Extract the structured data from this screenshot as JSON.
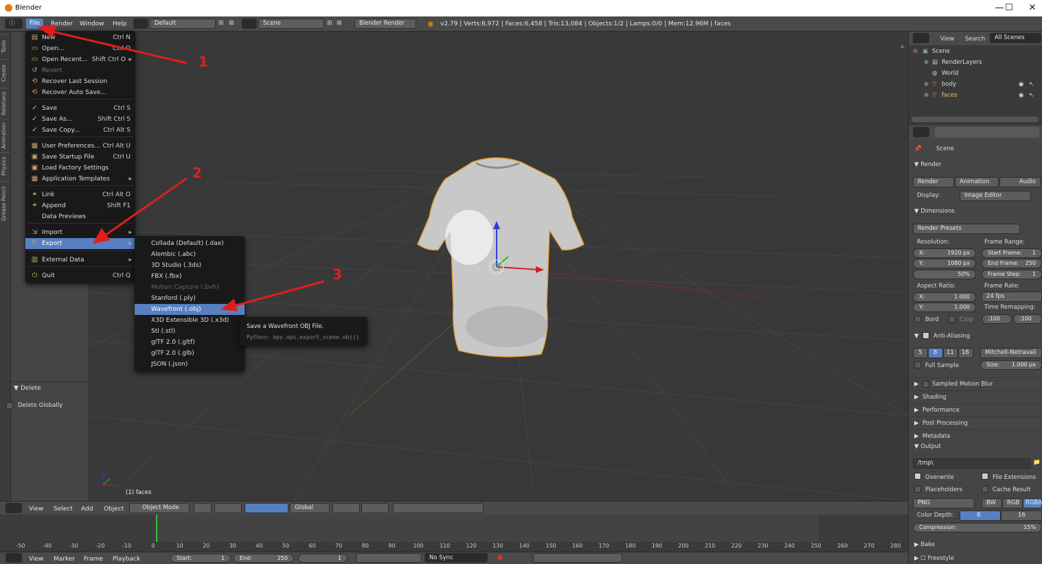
{
  "window": {
    "title": "Blender",
    "min": "—",
    "max": "☐",
    "close": "✕"
  },
  "infobar": {
    "menus": [
      "File",
      "Render",
      "Window",
      "Help"
    ],
    "layout": "Default",
    "scene": "Scene",
    "engine": "Blender Render",
    "stats": "v2.79 | Verts:6,972 | Faces:6,458 | Tris:13,084 | Objects:1/2 | Lamps:0/0 | Mem:12.96M | faces"
  },
  "toolshelf_tabs": [
    "Tools",
    "Create",
    "Relations",
    "Animation",
    "Physics",
    "Grease Pencil"
  ],
  "file_menu": {
    "items": [
      {
        "label": "New",
        "shortcut": "Ctrl N",
        "icon": "new-file-icon"
      },
      {
        "label": "Open...",
        "shortcut": "Ctrl O",
        "icon": "folder-icon"
      },
      {
        "label": "Open Recent...",
        "shortcut": "Shift Ctrl O",
        "icon": "folder-icon",
        "submenu": true
      },
      {
        "label": "Revert",
        "shortcut": "",
        "icon": "revert-icon",
        "disabled": true
      },
      {
        "label": "Recover Last Session",
        "shortcut": "",
        "icon": "recover-icon"
      },
      {
        "label": "Recover Auto Save...",
        "shortcut": "",
        "icon": "recover-icon"
      },
      {
        "label": "Save",
        "shortcut": "Ctrl S",
        "icon": "check-icon"
      },
      {
        "label": "Save As...",
        "shortcut": "Shift Ctrl S",
        "icon": "check-icon"
      },
      {
        "label": "Save Copy...",
        "shortcut": "Ctrl Alt S",
        "icon": "check-icon"
      },
      {
        "label": "User Preferences...",
        "shortcut": "Ctrl Alt U",
        "icon": "prefs-icon"
      },
      {
        "label": "Save Startup File",
        "shortcut": "Ctrl U",
        "icon": "save-icon"
      },
      {
        "label": "Load Factory Settings",
        "shortcut": "",
        "icon": "load-icon"
      },
      {
        "label": "Application Templates",
        "shortcut": "",
        "icon": "template-icon",
        "submenu": true
      },
      {
        "label": "Link",
        "shortcut": "Ctrl Alt O",
        "icon": "link-icon"
      },
      {
        "label": "Append",
        "shortcut": "Shift F1",
        "icon": "append-icon"
      },
      {
        "label": "Data Previews",
        "shortcut": "",
        "icon": ""
      },
      {
        "label": "Import",
        "shortcut": "",
        "icon": "import-icon",
        "submenu": true
      },
      {
        "label": "Export",
        "shortcut": "",
        "icon": "export-icon",
        "submenu": true,
        "highlighted": true
      },
      {
        "label": "External Data",
        "shortcut": "",
        "icon": "external-icon",
        "submenu": true
      },
      {
        "label": "Quit",
        "shortcut": "Ctrl Q",
        "icon": "power-icon"
      }
    ]
  },
  "export_menu": {
    "items": [
      {
        "label": "Collada (Default) (.dae)"
      },
      {
        "label": "Alembic (.abc)"
      },
      {
        "label": "3D Studio (.3ds)"
      },
      {
        "label": "FBX (.fbx)"
      },
      {
        "label": "Motion Capture (.bvh)",
        "disabled": true
      },
      {
        "label": "Stanford (.ply)"
      },
      {
        "label": "Wavefront (.obj)",
        "highlighted": true
      },
      {
        "label": "X3D Extensible 3D (.x3d)"
      },
      {
        "label": "Stl (.stl)"
      },
      {
        "label": "glTF 2.0 (.gltf)"
      },
      {
        "label": "glTF 2.0 (.glb)"
      },
      {
        "label": "JSON (.json)"
      }
    ]
  },
  "tooltip": {
    "title": "Save a Wavefront OBJ File.",
    "python": "Python: bpy.ops.export_scene.obj()"
  },
  "annotations": [
    "1",
    "2",
    "3"
  ],
  "operator_panel": {
    "title": "Delete",
    "option": "Delete Globally"
  },
  "viewport": {
    "object_label": "(1) faces"
  },
  "outliner": {
    "menus": [
      "View",
      "Search"
    ],
    "filter": "All Scenes",
    "items": [
      "Scene",
      "RenderLayers",
      "World",
      "body",
      "faces"
    ]
  },
  "properties": {
    "scene": "Scene",
    "render": {
      "title": "Render",
      "buttons": [
        "Render",
        "Animation",
        "Audio"
      ],
      "display_label": "Display:",
      "display_value": "Image Editor"
    },
    "dimensions": {
      "title": "Dimensions",
      "presets": "Render Presets",
      "resolution_label": "Resolution:",
      "x": "1920 px",
      "y": "1080 px",
      "pct": "50%",
      "frame_range_label": "Frame Range:",
      "start": "Start Frame:",
      "start_v": "1",
      "end": "End Frame:",
      "end_v": "250",
      "step": "Frame Step:",
      "step_v": "1",
      "aspect_label": "Aspect Ratio:",
      "ax": "1.000",
      "ay": "1.000",
      "frame_rate_label": "Frame Rate:",
      "fps": "24 fps",
      "remap_label": "Time Remapping:",
      "old": ":100",
      "new": ":100",
      "bord": "Bord",
      "crop": "Crop",
      "x_lbl": "X:",
      "y_lbl": "Y:"
    },
    "aa": {
      "title": "Anti-Aliasing",
      "samples": [
        "5",
        "8",
        "11",
        "16"
      ],
      "filter": "Mitchell-Netravali",
      "full_sample": "Full Sample",
      "size": "Size:",
      "size_v": "1.000 px"
    },
    "collapsed": [
      "Sampled Motion Blur",
      "Shading",
      "Performance",
      "Post Processing",
      "Metadata"
    ],
    "output": {
      "title": "Output",
      "path": "/tmp\\",
      "overwrite": "Overwrite",
      "file_ext": "File Extensions",
      "placeholders": "Placeholders",
      "cache": "Cache Result",
      "format": "PNG",
      "modes": [
        "BW",
        "RGB",
        "RGBA"
      ],
      "depth_label": "Color Depth:",
      "depths": [
        "8",
        "16"
      ],
      "compression": "Compression:",
      "compression_v": "15%"
    },
    "bottom": [
      "Bake",
      "Freestyle"
    ]
  },
  "vp_header": {
    "menus": [
      "View",
      "Select",
      "Add",
      "Object"
    ],
    "mode": "Object Mode",
    "orientation": "Global"
  },
  "timeline": {
    "ticks": [
      "-50",
      "-40",
      "-30",
      "-20",
      "-10",
      "0",
      "10",
      "20",
      "30",
      "40",
      "50",
      "60",
      "70",
      "80",
      "90",
      "100",
      "110",
      "120",
      "130",
      "140",
      "150",
      "160",
      "170",
      "180",
      "190",
      "200",
      "210",
      "220",
      "230",
      "240",
      "250",
      "260",
      "270",
      "280"
    ],
    "menus": [
      "View",
      "Marker",
      "Frame",
      "Playback"
    ],
    "start_lbl": "Start:",
    "start": "1",
    "end_lbl": "End:",
    "end": "250",
    "current": "1",
    "sync": "No Sync"
  }
}
